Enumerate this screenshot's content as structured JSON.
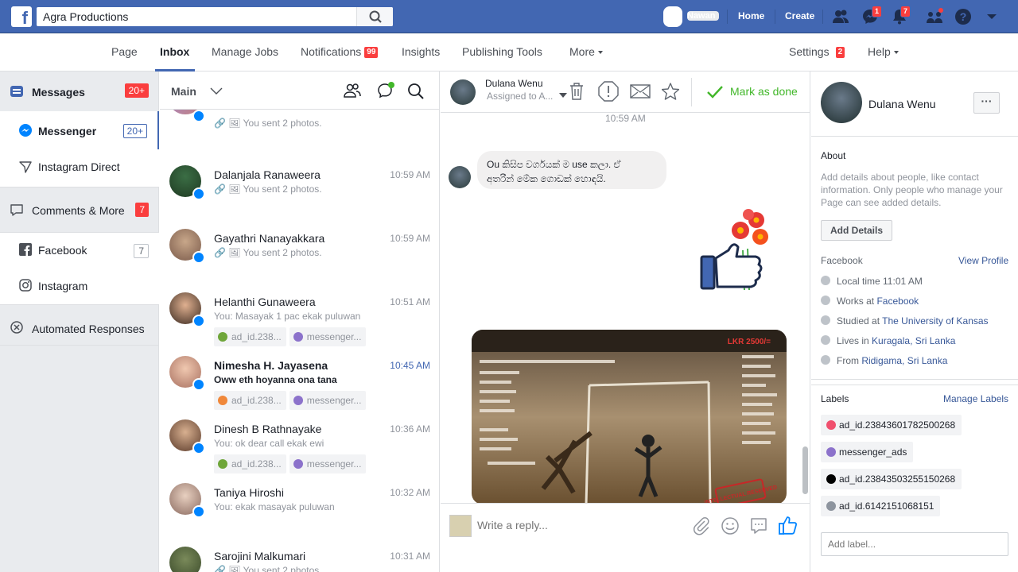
{
  "topbar": {
    "logo": "f",
    "search_value": "Agra Productions",
    "user_name": "Nawan",
    "home": "Home",
    "create": "Create",
    "messages_badge": "1",
    "notifications_badge": "7"
  },
  "pagenav": {
    "page": "Page",
    "inbox": "Inbox",
    "manage_jobs": "Manage Jobs",
    "notifications": "Notifications",
    "notifications_badge": "99",
    "insights": "Insights",
    "publishing_tools": "Publishing Tools",
    "more": "More",
    "settings": "Settings",
    "settings_badge": "2",
    "help": "Help"
  },
  "sidebar": {
    "messages": "Messages",
    "messages_count": "20+",
    "messenger": "Messenger",
    "messenger_count": "20+",
    "instagram_direct": "Instagram Direct",
    "comments_more": "Comments & More",
    "comments_count": "7",
    "facebook": "Facebook",
    "facebook_count": "7",
    "instagram": "Instagram",
    "automated": "Automated Responses"
  },
  "convlist": {
    "title": "Main",
    "partial_snippet": "You sent 2 photos.",
    "conversations": [
      {
        "name": "Dalanjala Ranaweera",
        "time": "10:59 AM",
        "snippet": "You sent 2 photos."
      },
      {
        "name": "Gayathri Nanayakkara",
        "time": "10:59 AM",
        "snippet": "You sent 2 photos."
      },
      {
        "name": "Helanthi Gunaweera",
        "time": "10:51 AM",
        "snippet": "You: Masayak 1 pac ekak puluwan",
        "tag1": "ad_id.238...",
        "tag2": "messenger..."
      },
      {
        "name": "Nimesha H. Jayasena",
        "time": "10:45 AM",
        "snippet": "Oww eth hoyanna ona tana",
        "tag1": "ad_id.238...",
        "tag2": "messenger..."
      },
      {
        "name": "Dinesh B Rathnayake",
        "time": "10:36 AM",
        "snippet": "You: ok dear call ekak ewi",
        "tag1": "ad_id.238...",
        "tag2": "messenger..."
      },
      {
        "name": "Taniya Hiroshi",
        "time": "10:32 AM",
        "snippet": "You: ekak masayak puluwan"
      },
      {
        "name": "Sarojini Malkumari",
        "time": "10:31 AM",
        "snippet": "You sent 2 photos."
      }
    ]
  },
  "chat": {
    "contact_name": "Dulana Wenu",
    "assigned": "Assigned to A...",
    "mark_done": "Mark as done",
    "timestamp": "10:59 AM",
    "message_line1": "Ou කිසිප වර්ගයක් ම use කලා. ඒ",
    "message_line2": "අතරින් මේක ගොඩක් හොඳයි.",
    "price_tag": "LKR 2500/=",
    "stamp_text": "INTELLECTUAL RESERVED",
    "reply_placeholder": "Write a reply..."
  },
  "right": {
    "name": "Dulana Wenu",
    "more": "···",
    "about": "About",
    "about_desc": "Add details about people, like contact information. Only people who manage your Page can see added details.",
    "add_details": "Add Details",
    "facebook": "Facebook",
    "view_profile": "View Profile",
    "local_time": "Local time 11:01 AM",
    "works_prefix": "Works at ",
    "works_link": "Facebook",
    "studied_prefix": "Studied at ",
    "studied_link": "The University of Kansas",
    "lives_prefix": "Lives in ",
    "lives_link": "Kuragala, Sri Lanka",
    "from_prefix": "From ",
    "from_link": "Ridigama, Sri Lanka",
    "labels": "Labels",
    "manage_labels": "Manage Labels",
    "label_items": [
      {
        "text": "ad_id.23843601782500268",
        "color": "#f0506e"
      },
      {
        "text": "messenger_ads",
        "color": "#8c72cb"
      },
      {
        "text": "ad_id.23843503255150268",
        "color": "#000000"
      },
      {
        "text": "ad_id.6142151068151",
        "color": "#8d949e"
      }
    ],
    "add_label_placeholder": "Add label..."
  },
  "colors": {
    "brand_blue": "#4267b2",
    "badge_red": "#fa3e3e",
    "done_green": "#42b72a",
    "messenger_blue": "#0084ff"
  }
}
